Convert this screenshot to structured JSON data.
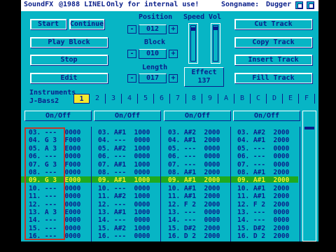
{
  "titlebar": {
    "app": "SoundFX",
    "copyright": "@1988 LINEL",
    "notice": "Only for internal use!",
    "songname_label": "Songname:",
    "songname": "Dugger"
  },
  "left_buttons": [
    "Start",
    "Continue",
    "Play Block",
    "Stop",
    "Edit"
  ],
  "position": {
    "label": "Position",
    "value": "012"
  },
  "block": {
    "label": "Block",
    "value": "010"
  },
  "length": {
    "label": "Length",
    "value": "017"
  },
  "minus": "-",
  "plus": "+",
  "speed_label": "Speed",
  "vol_label": "Vol",
  "effect": {
    "label": "Effect",
    "value": "137"
  },
  "right_buttons": [
    "Cut Track",
    "Copy Track",
    "Insert Track",
    "Fill Track"
  ],
  "instruments": {
    "label": "Instruments",
    "current": "J-Bass2",
    "slots": [
      "1",
      "2",
      "3",
      "4",
      "5",
      "6",
      "7",
      "8",
      "9",
      "A",
      "B",
      "C",
      "D",
      "E",
      "F"
    ],
    "selected_index": 0
  },
  "channels": [
    {
      "header": "On/Off",
      "rows": [
        {
          "n": "03.",
          "note": "---",
          "val": "0000"
        },
        {
          "n": "04.",
          "note": "G 3",
          "val": "F000"
        },
        {
          "n": "05.",
          "note": "A 3",
          "val": "E000"
        },
        {
          "n": "06.",
          "note": "---",
          "val": "0000"
        },
        {
          "n": "07.",
          "note": "G 3",
          "val": "F000"
        },
        {
          "n": "08.",
          "note": "---",
          "val": "0000"
        },
        {
          "n": "09.",
          "note": "G 3",
          "val": "E000"
        },
        {
          "n": "10.",
          "note": "---",
          "val": "0000"
        },
        {
          "n": "11.",
          "note": "---",
          "val": "0000"
        },
        {
          "n": "12.",
          "note": "---",
          "val": "0000"
        },
        {
          "n": "13.",
          "note": "A 3",
          "val": "E000"
        },
        {
          "n": "14.",
          "note": "---",
          "val": "0000"
        },
        {
          "n": "15.",
          "note": "---",
          "val": "0000"
        },
        {
          "n": "16.",
          "note": "---",
          "val": "0000"
        }
      ]
    },
    {
      "header": "On/Off",
      "rows": [
        {
          "n": "03.",
          "note": "A#1",
          "val": "1000"
        },
        {
          "n": "04.",
          "note": "---",
          "val": "0000"
        },
        {
          "n": "05.",
          "note": "A#2",
          "val": "1000"
        },
        {
          "n": "06.",
          "note": "---",
          "val": "0000"
        },
        {
          "n": "07.",
          "note": "A#1",
          "val": "1000"
        },
        {
          "n": "08.",
          "note": "---",
          "val": "0000"
        },
        {
          "n": "09.",
          "note": "A#1",
          "val": "1000"
        },
        {
          "n": "10.",
          "note": "---",
          "val": "0000"
        },
        {
          "n": "11.",
          "note": "A#2",
          "val": "1000"
        },
        {
          "n": "12.",
          "note": "---",
          "val": "0000"
        },
        {
          "n": "13.",
          "note": "A#1",
          "val": "1000"
        },
        {
          "n": "14.",
          "note": "---",
          "val": "0000"
        },
        {
          "n": "15.",
          "note": "A#2",
          "val": "1000"
        },
        {
          "n": "16.",
          "note": "---",
          "val": "0000"
        }
      ]
    },
    {
      "header": "On/Off",
      "rows": [
        {
          "n": "03.",
          "note": "A#2",
          "val": "2000"
        },
        {
          "n": "04.",
          "note": "A#1",
          "val": "2000"
        },
        {
          "n": "05.",
          "note": "---",
          "val": "0000"
        },
        {
          "n": "06.",
          "note": "---",
          "val": "0000"
        },
        {
          "n": "07.",
          "note": "---",
          "val": "0000"
        },
        {
          "n": "08.",
          "note": "A#1",
          "val": "2000"
        },
        {
          "n": "09.",
          "note": "A#1",
          "val": "2000"
        },
        {
          "n": "10.",
          "note": "A#1",
          "val": "2000"
        },
        {
          "n": "11.",
          "note": "A#1",
          "val": "2000"
        },
        {
          "n": "12.",
          "note": "F 2",
          "val": "2000"
        },
        {
          "n": "13.",
          "note": "---",
          "val": "0000"
        },
        {
          "n": "14.",
          "note": "---",
          "val": "0000"
        },
        {
          "n": "15.",
          "note": "D#2",
          "val": "2000"
        },
        {
          "n": "16.",
          "note": "D 2",
          "val": "2000"
        }
      ]
    },
    {
      "header": "On/Off",
      "rows": [
        {
          "n": "03.",
          "note": "A#2",
          "val": "2000"
        },
        {
          "n": "04.",
          "note": "A#1",
          "val": "2000"
        },
        {
          "n": "05.",
          "note": "---",
          "val": "0000"
        },
        {
          "n": "06.",
          "note": "---",
          "val": "0000"
        },
        {
          "n": "07.",
          "note": "---",
          "val": "0000"
        },
        {
          "n": "08.",
          "note": "A#1",
          "val": "2000"
        },
        {
          "n": "09.",
          "note": "A#1",
          "val": "2000"
        },
        {
          "n": "10.",
          "note": "A#1",
          "val": "2000"
        },
        {
          "n": "11.",
          "note": "A#1",
          "val": "2000"
        },
        {
          "n": "12.",
          "note": "F 2",
          "val": "2000"
        },
        {
          "n": "13.",
          "note": "---",
          "val": "0000"
        },
        {
          "n": "14.",
          "note": "---",
          "val": "0000"
        },
        {
          "n": "15.",
          "note": "D#2",
          "val": "2000"
        },
        {
          "n": "16.",
          "note": "D 2",
          "val": "2000"
        }
      ]
    }
  ],
  "playing_row": 6,
  "colors": {
    "background": "#07B5C5",
    "ink": "#0a1f8a",
    "highlight": "#f4e92d",
    "playbar": "#1faa1f",
    "cursor": "#c0392b"
  }
}
